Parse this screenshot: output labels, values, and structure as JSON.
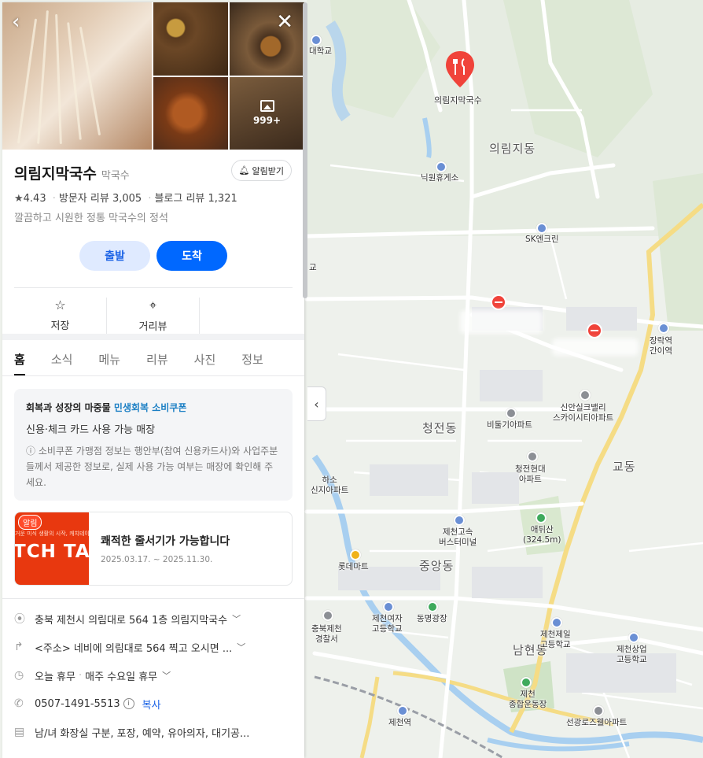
{
  "panel": {
    "photos": {
      "more_count": "999+"
    },
    "place": {
      "name": "의림지막국수",
      "category": "막국수",
      "alarm_label": "알림받기",
      "rating": "4.43",
      "visitor_reviews": "방문자 리뷰 3,005",
      "blog_reviews": "블로그 리뷰 1,321",
      "description": "깔끔하고 시원한 정통 막국수의 정석"
    },
    "route": {
      "start_label": "출발",
      "end_label": "도착"
    },
    "actions": [
      {
        "label": "저장",
        "icon": "star-outline-icon"
      },
      {
        "label": "거리뷰",
        "icon": "location-pin-icon"
      }
    ],
    "tabs": [
      "홈",
      "소식",
      "메뉴",
      "리뷰",
      "사진",
      "정보"
    ],
    "active_tab": "홈",
    "notice": {
      "line1_prefix": "회복과 성장의 마중물",
      "line1_highlight": "민생회복 소비쿠폰",
      "line2": "신용·체크 카드 사용 가능 매장",
      "line3": "소비쿠폰 가맹점 정보는 행안부(참여 신용카드사)와 사업주분들께서 제공한 정보로, 실제 사용 가능 여부는 매장에 확인해 주세요."
    },
    "promo": {
      "badge": "알림",
      "image_small_text": "거운 미식 생활의 시작, 캐치테이",
      "image_big_text": "TCH TAB",
      "title": "쾌적한 줄서기가 가능합니다",
      "period": "2025.03.17. ~ 2025.11.30."
    },
    "info": {
      "address": "충북 제천시 의림대로 564 1층 의림지막국수",
      "directions": "<주소> 네비에 의림대로 564 찍고 오시면 ...",
      "hours_status": "오늘 휴무",
      "hours_detail": "매주 수요일 휴무",
      "phone": "0507-1491-5513",
      "copy_label": "복사",
      "amenities": "남/녀 화장실 구분, 포장, 예약, 유아의자, 대기공..."
    }
  },
  "map": {
    "labels": {
      "restaurant": "의림지막국수",
      "dong_uirim": "의림지동",
      "dong_cheongjeon": "청전동",
      "dong_jungang": "중앙동",
      "dong_namhyeon": "남현동",
      "dong_gyo": "교동",
      "rest_area": "닉원휴게소",
      "sk": "SK엔크린",
      "jangrak": "장락역\n간이역",
      "sinan": "신안실크밸리\n스카이시티아파트",
      "bidulgi": "비둘기아파트",
      "cheongjeon_hyundai": "청전현대\n아파트",
      "terminal": "제천고속\n버스터미널",
      "aedwisan": "애뒤산\n(324.5m)",
      "lotte": "롯데마트",
      "girls_high": "제천여자\n고등학교",
      "dongmyeong": "동명광장",
      "police": "충북제천\n경찰서",
      "jecheon_cheil": "제천제일\n고등학교",
      "jecheon_sangeop": "제천상업\n고등학교",
      "stadium": "제천\n종합운동장",
      "jecheon_station": "제천역",
      "seongwang": "선광로즈웰아파트",
      "univ": "대학교",
      "hasodong": "하소\n신지아파트",
      "left_edge": "교"
    },
    "colors": {
      "road_major": "#ffffff",
      "road_arterial": "#f7e08a",
      "water": "#a8cff0",
      "green": "#cfe6c6",
      "pin": "#f0433a"
    }
  }
}
